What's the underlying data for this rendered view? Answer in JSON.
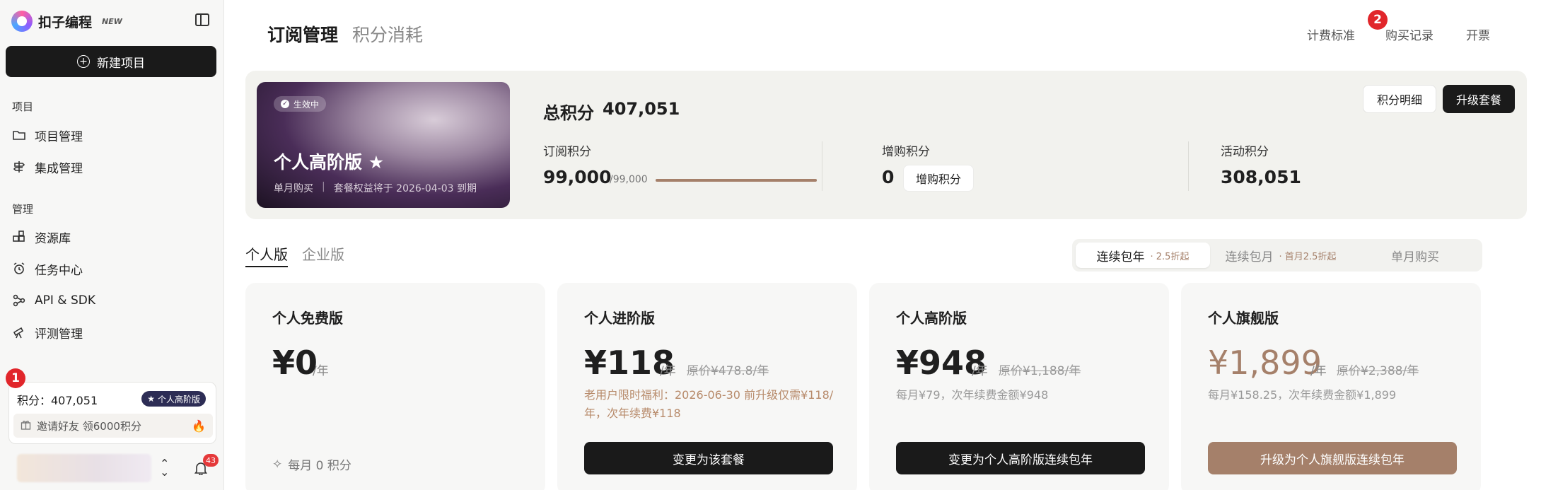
{
  "app": {
    "name": "扣子编程",
    "badge": "NEW"
  },
  "sidebar": {
    "new_project": "新建项目",
    "section_projects": "项目",
    "section_manage": "管理",
    "items": [
      {
        "label": "项目管理",
        "icon": "folder-icon"
      },
      {
        "label": "集成管理",
        "icon": "signpost-icon"
      },
      {
        "label": "资源库",
        "icon": "blocks-icon"
      },
      {
        "label": "任务中心",
        "icon": "alarm-icon"
      },
      {
        "label": "API & SDK",
        "icon": "share-icon"
      },
      {
        "label": "评测管理",
        "icon": "telescope-icon"
      }
    ],
    "points_label": "积分：407,051",
    "plan_badge": "个人高阶版",
    "invite": "邀请好友 领6000积分",
    "notif_count": "43"
  },
  "markers": {
    "one": "1",
    "two": "2"
  },
  "header": {
    "tab_subscription": "订阅管理",
    "tab_points": "积分消耗",
    "link_pricing": "计费标准",
    "link_purchases": "购买记录",
    "link_invoice": "开票"
  },
  "summary": {
    "status": "生效中",
    "plan_name": "个人高阶版 ★",
    "plan_purchase": "单月购买",
    "plan_expiry": "套餐权益将于 2026-04-03 到期",
    "total_label": "总积分",
    "total_value": "407,051",
    "detail_button": "积分明细",
    "upgrade_button": "升级套餐",
    "subscription_label": "订阅积分",
    "subscription_value": "99,000",
    "subscription_max": "/99,000",
    "subscription_fill": 1.0,
    "extra_label": "增购积分",
    "extra_value": "0",
    "extra_button": "增购积分",
    "activity_label": "活动积分",
    "activity_value": "308,051"
  },
  "editions": {
    "personal": "个人版",
    "enterprise": "企业版"
  },
  "billing": {
    "annual": "连续包年",
    "annual_discount": "· 2.5折起",
    "monthly_continuous": "连续包月",
    "monthly_discount": "· 首月2.5折起",
    "single_month": "单月购买"
  },
  "plans": [
    {
      "title": "个人免费版",
      "price": "¥0",
      "unit": "/年",
      "monthly": "每月 0 积分"
    },
    {
      "title": "个人进阶版",
      "price": "¥118",
      "unit": "/年",
      "original": "原价¥478.8/年",
      "note": "老用户限时福利：2026-06-30 前升级仅需¥118/年，次年续费¥118",
      "button": "变更为该套餐"
    },
    {
      "title": "个人高阶版",
      "price": "¥948",
      "unit": "/年",
      "original": "原价¥1,188/年",
      "note": "每月¥79，次年续费金额¥948",
      "button": "变更为个人高阶版连续包年"
    },
    {
      "title": "个人旗舰版",
      "price": "¥1,899",
      "unit": "/年",
      "original": "原价¥2,388/年",
      "note": "每月¥158.25，次年续费金额¥1,899",
      "button": "升级为个人旗舰版连续包年"
    }
  ],
  "colors": {
    "accent_gold": "#a5806a",
    "primary_dark": "#1a1a1a",
    "marker_red": "#e1262b"
  }
}
